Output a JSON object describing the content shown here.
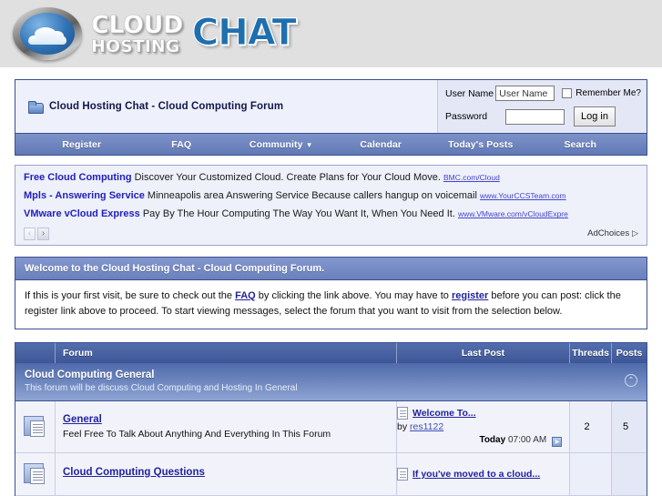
{
  "branding": {
    "logo_cloud": "CLOUD",
    "logo_hosting": "HOSTING",
    "logo_chat": "CHAT",
    "accent_blue": "#1e6fb0",
    "nav_blue": "#6179b5",
    "header_border": "#3a4f8f"
  },
  "forum_header": {
    "title": "Cloud Hosting Chat - Cloud Computing Forum",
    "login": {
      "username_label": "User Name",
      "username_value": "User Name",
      "username_placeholder": "User Name",
      "password_label": "Password",
      "password_value": "",
      "remember_label": "Remember Me?",
      "login_button": "Log in"
    }
  },
  "navbar": {
    "items": [
      {
        "label": "Register"
      },
      {
        "label": "FAQ"
      },
      {
        "label": "Community",
        "caret": "▼"
      },
      {
        "label": "Calendar"
      },
      {
        "label": "Today's Posts"
      },
      {
        "label": "Search"
      }
    ]
  },
  "ads": {
    "rows": [
      {
        "title": "Free Cloud Computing",
        "desc": "Discover Your Customized Cloud. Create Plans for Your Cloud Move.",
        "url": "BMC.com/Cloud"
      },
      {
        "title": "Mpls - Answering Service",
        "desc": "Minneapolis area Answering Service Because callers hangup on voicemail",
        "url": "www.YourCCSTeam.com"
      },
      {
        "title": "VMware vCloud Express",
        "desc": "Pay By The Hour Computing The Way You Want It, When You Need It.",
        "url": "www.VMware.com/vCloudExpre"
      }
    ],
    "prev_arrow": "‹",
    "next_arrow": "›",
    "adchoices_label": "AdChoices",
    "adchoices_glyph": "▷"
  },
  "welcome": {
    "heading": "Welcome to the Cloud Hosting Chat - Cloud Computing Forum.",
    "text_1": "If this is your first visit, be sure to check out the ",
    "faq_link": "FAQ",
    "text_2": " by clicking the link above. You may have to ",
    "register_link": "register",
    "text_3": " before you can post: click the register link above to proceed. To start viewing messages, select the forum that you want to visit from the selection below."
  },
  "forum_table": {
    "columns": {
      "forum": "Forum",
      "last_post": "Last Post",
      "threads": "Threads",
      "posts": "Posts"
    },
    "category": {
      "title": "Cloud Computing General",
      "description": "This forum will be discuss Cloud Computing and Hosting In General",
      "collapse_glyph": "⌃"
    },
    "rows": [
      {
        "name": "General",
        "description": "Feel Free To Talk About Anything And Everything In This Forum",
        "last_post_title": "Welcome To...",
        "last_post_by_label": "by",
        "last_post_author": "res1122",
        "last_post_day": "Today",
        "last_post_time": "07:00 AM",
        "goto_glyph": "➤",
        "threads": "2",
        "posts": "5"
      },
      {
        "name": "Cloud Computing Questions",
        "description": "",
        "last_post_title": "If you've moved to a cloud...",
        "last_post_by_label": "",
        "last_post_author": "",
        "last_post_day": "",
        "last_post_time": "",
        "goto_glyph": "",
        "threads": "",
        "posts": ""
      }
    ]
  }
}
